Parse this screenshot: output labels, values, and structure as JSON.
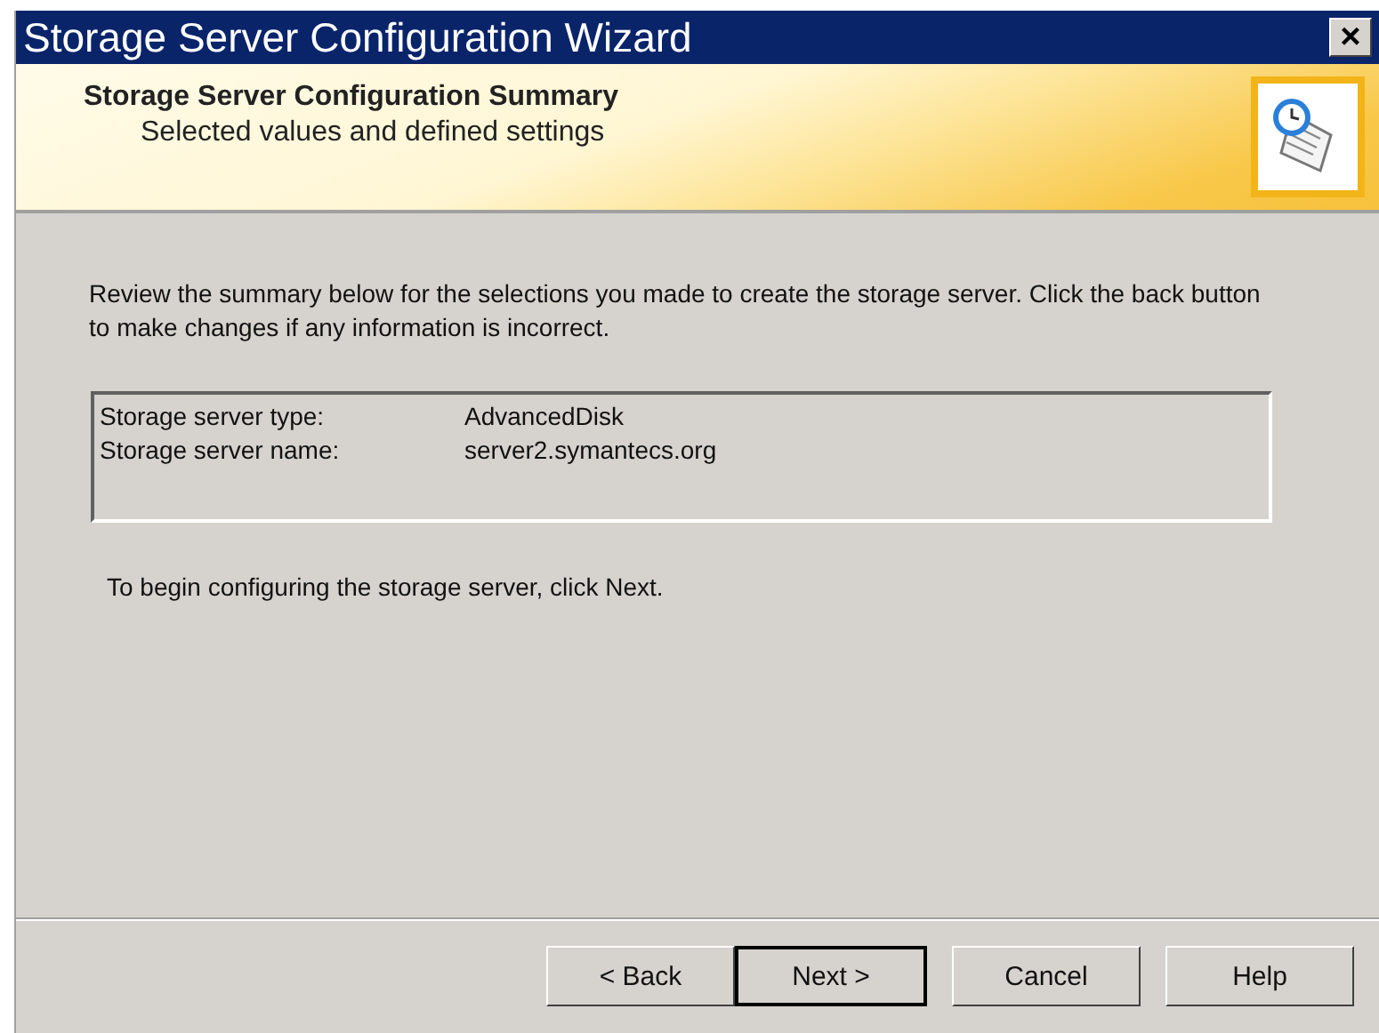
{
  "window": {
    "title": "Storage Server Configuration Wizard",
    "close": "×"
  },
  "header": {
    "title": "Storage Server Configuration Summary",
    "subtitle": "Selected values and defined settings"
  },
  "intro": "Review the summary below for the selections you made to create the storage server. Click the back button to make changes if any information is incorrect.",
  "summary": [
    {
      "label": "Storage server type:",
      "value": "AdvancedDisk"
    },
    {
      "label": "Storage server name:",
      "value": "server2.symantecs.org"
    }
  ],
  "closing": "To begin configuring the storage server, click Next.",
  "buttons": [
    {
      "label": "< Back",
      "default": false
    },
    {
      "label": "Next >",
      "default": true
    },
    {
      "label": "Cancel",
      "default": false
    },
    {
      "label": "Help",
      "default": false
    }
  ]
}
